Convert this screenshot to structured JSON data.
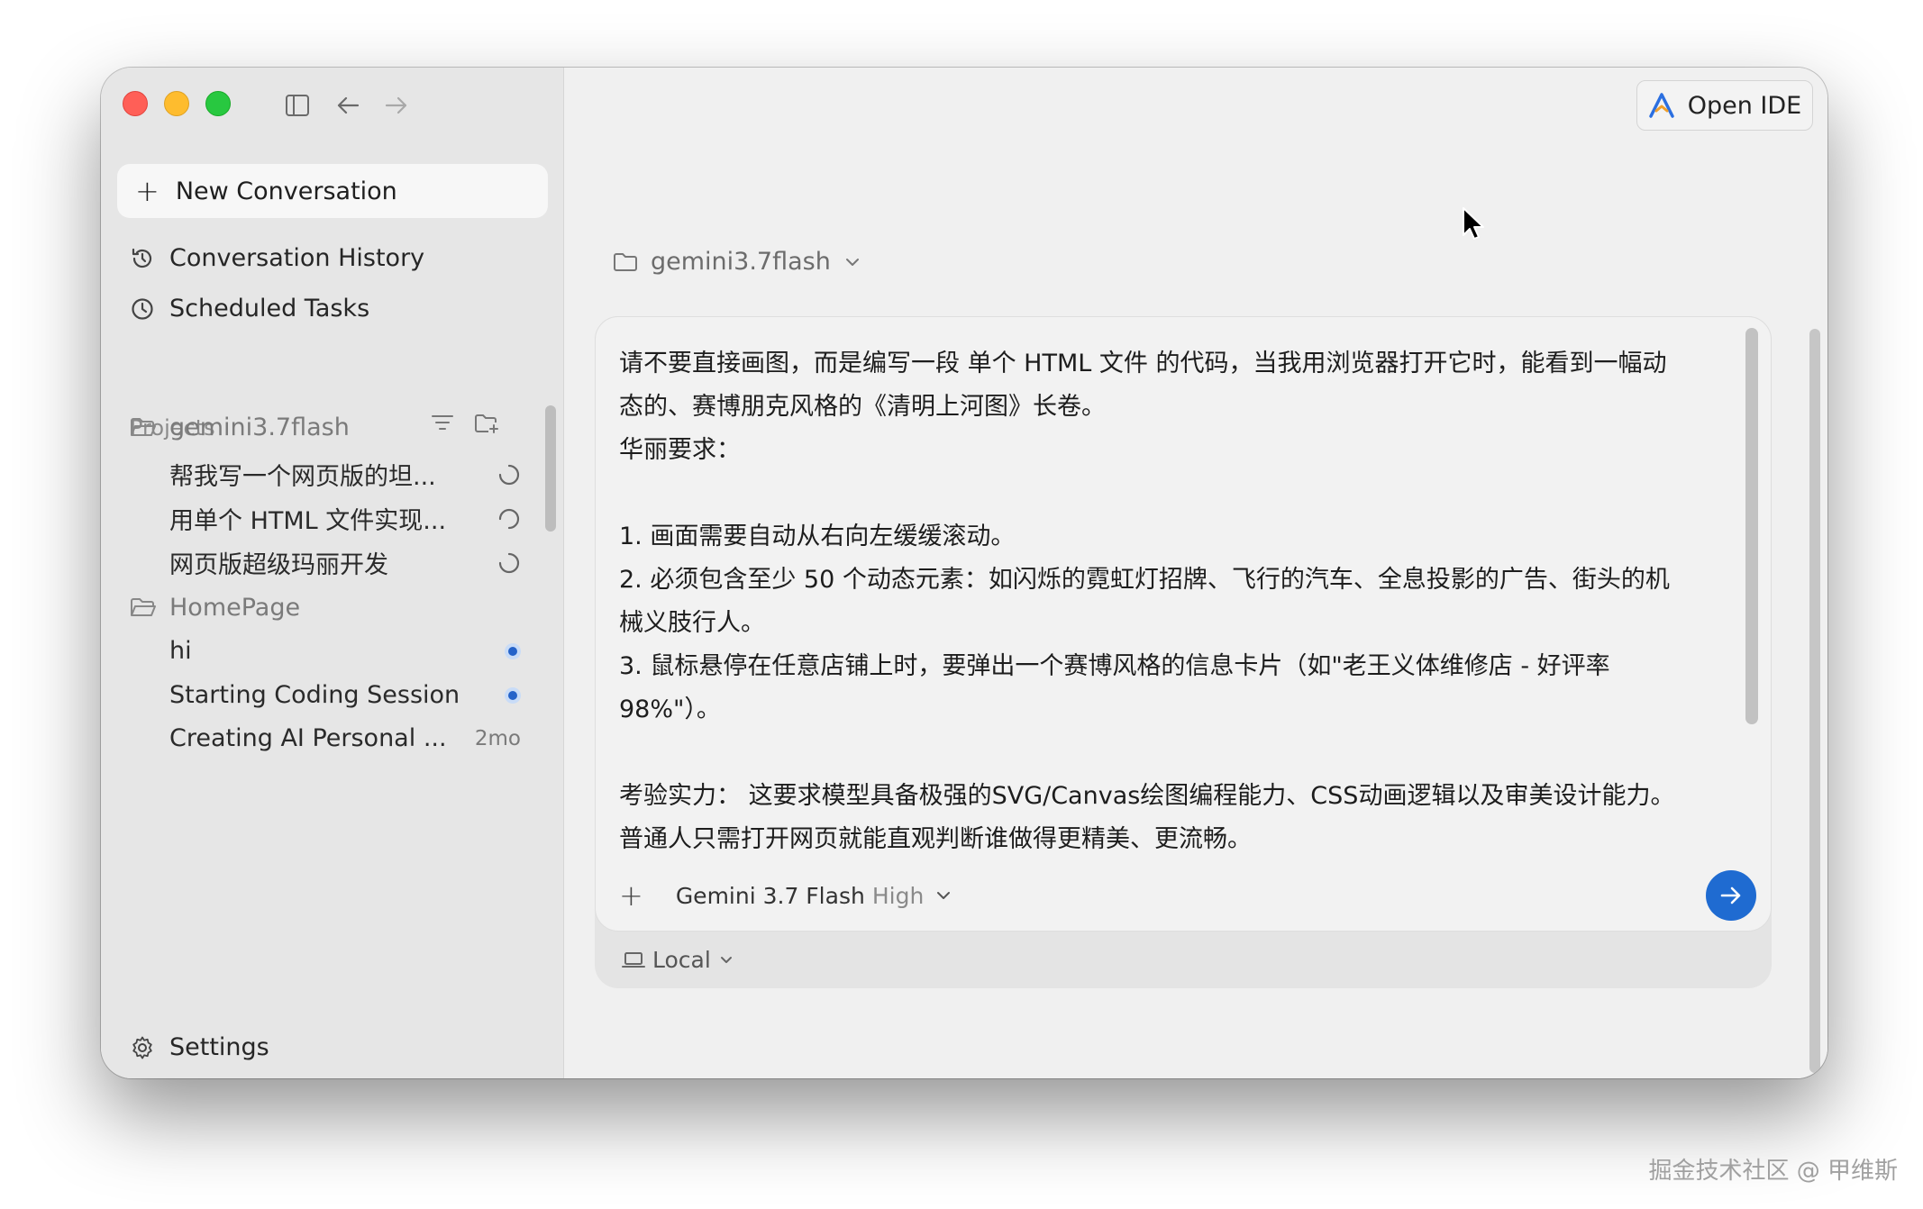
{
  "sidebar": {
    "new_conversation": "New Conversation",
    "history": "Conversation History",
    "scheduled": "Scheduled Tasks",
    "projects_label": "Projects",
    "projects": [
      {
        "name": "gemini3.7flash",
        "items": [
          {
            "title": "帮我写一个网页版的坦...",
            "status": "loading"
          },
          {
            "title": "用单个 HTML 文件实现...",
            "status": "loading"
          },
          {
            "title": "网页版超级玛丽开发",
            "status": "loading"
          }
        ]
      },
      {
        "name": "HomePage",
        "items": [
          {
            "title": "hi",
            "status": "unread"
          },
          {
            "title": "Starting Coding Session",
            "status": "unread"
          },
          {
            "title": "Creating AI Personal ...",
            "status": "2mo"
          }
        ]
      }
    ],
    "settings": "Settings"
  },
  "header": {
    "open_ide": "Open IDE"
  },
  "main": {
    "project_selector": "gemini3.7flash",
    "composer": {
      "lines": [
        "请不要直接画图，而是编写一段 单个 HTML 文件 的代码，当我用浏览器打开它时，能看到一幅动",
        "态的、赛博朋克风格的《清明上河图》长卷。",
        "华丽要求：",
        "",
        "1. 画面需要自动从右向左缓缓滚动。",
        "2. 必须包含至少 50 个动态元素：如闪烁的霓虹灯招牌、飞行的汽车、全息投影的广告、街头的机",
        "械义肢行人。",
        "3. 鼠标悬停在任意店铺上时，要弹出一个赛博风格的信息卡片（如\"老王义体维修店 - 好评率",
        "98%\"）。",
        "",
        "考验实力：  这要求模型具备极强的SVG/Canvas绘图编程能力、CSS动画逻辑以及审美设计能力。",
        "普通人只需打开网页就能直观判断谁做得更精美、更流畅。"
      ],
      "model": "Gemini 3.7 Flash",
      "model_level": "High",
      "environment": "Local"
    }
  },
  "watermark": "掘金技术社区 @ 甲维斯",
  "colors": {
    "accent": "#1f6bd1",
    "close": "#ff5f57",
    "minimize": "#febc2e",
    "zoom": "#28c840"
  }
}
